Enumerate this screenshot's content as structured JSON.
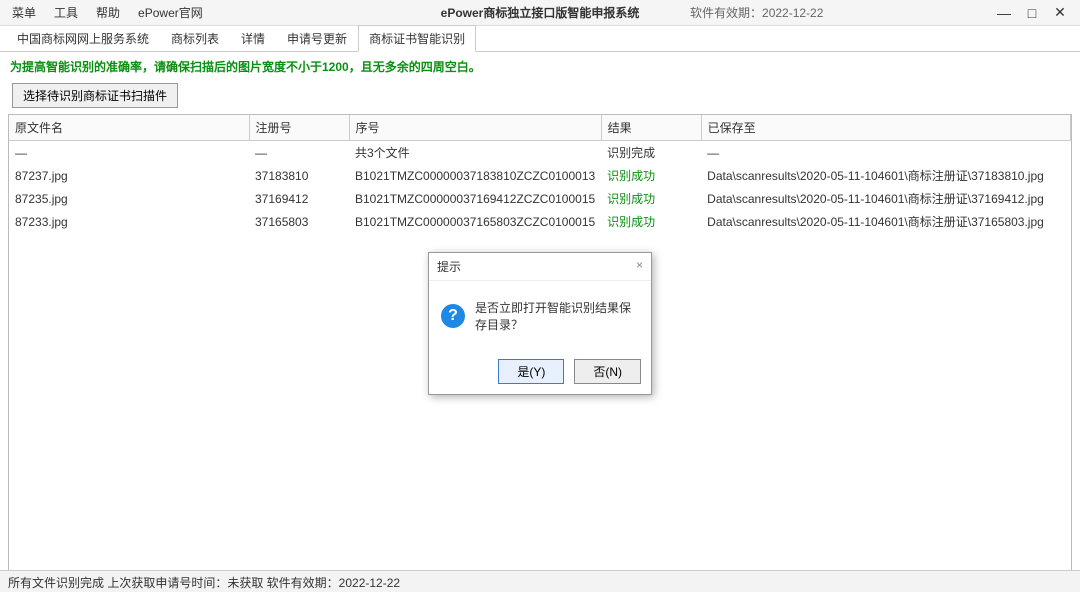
{
  "menubar": {
    "items": [
      "菜单",
      "工具",
      "帮助",
      "ePower官网"
    ]
  },
  "titlebar": {
    "title": "ePower商标独立接口版智能申报系统",
    "expiry_label": "软件有效期：",
    "expiry_date": "2022-12-22"
  },
  "win": {
    "min": "—",
    "max": "□",
    "close": "✕"
  },
  "tabs": {
    "items": [
      "中国商标网网上服务系统",
      "商标列表",
      "详情",
      "申请号更新",
      "商标证书智能识别"
    ],
    "active_index": 4
  },
  "hint": "为提高智能识别的准确率，请确保扫描后的图片宽度不小于1200，且无多余的四周空白。",
  "select_button": "选择待识别商标证书扫描件",
  "table": {
    "headers": {
      "file": "原文件名",
      "reg": "注册号",
      "seq": "序号",
      "result": "结果",
      "saved": "已保存至"
    },
    "summary": {
      "file": "—",
      "reg": "—",
      "seq": "共3个文件",
      "result": "识别完成",
      "saved": "—"
    },
    "rows": [
      {
        "file": "87237.jpg",
        "reg": "37183810",
        "seq": "B1021TMZC00000037183810ZCZC0100013",
        "result": "识别成功",
        "saved": "Data\\scanresults\\2020-05-11-104601\\商标注册证\\37183810.jpg"
      },
      {
        "file": "87235.jpg",
        "reg": "37169412",
        "seq": "B1021TMZC00000037169412ZCZC0100015",
        "result": "识别成功",
        "saved": "Data\\scanresults\\2020-05-11-104601\\商标注册证\\37169412.jpg"
      },
      {
        "file": "87233.jpg",
        "reg": "37165803",
        "seq": "B1021TMZC00000037165803ZCZC0100015",
        "result": "识别成功",
        "saved": "Data\\scanresults\\2020-05-11-104601\\商标注册证\\37165803.jpg"
      }
    ]
  },
  "dialog": {
    "title": "提示",
    "message": "是否立即打开智能识别结果保存目录？",
    "yes": "是(Y)",
    "no": "否(N)"
  },
  "statusbar": {
    "text": "所有文件识别完成   上次获取申请号时间：未获取   软件有效期：2022-12-22"
  }
}
